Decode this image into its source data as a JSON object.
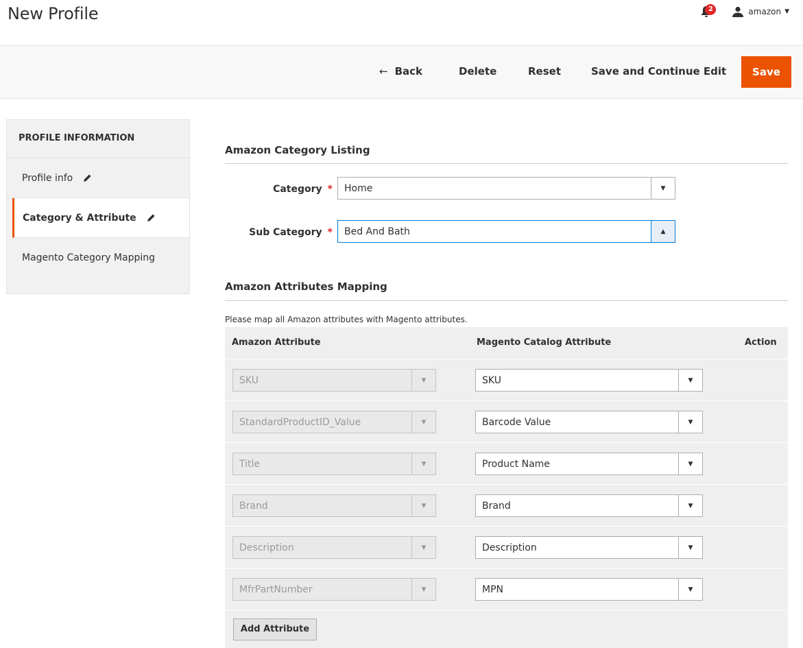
{
  "header": {
    "title": "New Profile",
    "notification_count": "2",
    "user_name": "amazon"
  },
  "toolbar": {
    "back_label": "Back",
    "delete_label": "Delete",
    "reset_label": "Reset",
    "save_continue_label": "Save and Continue Edit",
    "save_label": "Save"
  },
  "sidebar": {
    "heading": "PROFILE INFORMATION",
    "items": [
      {
        "label": "Profile info"
      },
      {
        "label": "Category & Attribute"
      },
      {
        "label": "Magento Category Mapping"
      }
    ]
  },
  "category_listing": {
    "title": "Amazon Category Listing",
    "category_label": "Category",
    "category_value": "Home",
    "subcategory_label": "Sub Category",
    "subcategory_value": "Bed And Bath"
  },
  "attributes_mapping": {
    "title": "Amazon Attributes Mapping",
    "note": "Please map all Amazon attributes with Magento attributes.",
    "columns": [
      "Amazon Attribute",
      "Magento Catalog Attribute",
      "Action"
    ],
    "rows": [
      {
        "amazon": "SKU",
        "magento": "SKU"
      },
      {
        "amazon": "StandardProductID_Value",
        "magento": "Barcode Value"
      },
      {
        "amazon": "Title",
        "magento": "Product Name"
      },
      {
        "amazon": "Brand",
        "magento": "Brand"
      },
      {
        "amazon": "Description",
        "magento": "Description"
      },
      {
        "amazon": "MfrPartNumber",
        "magento": "MPN"
      }
    ],
    "add_button_label": "Add Attribute"
  },
  "colors": {
    "accent": "#eb5202",
    "focus": "#007bdb"
  }
}
